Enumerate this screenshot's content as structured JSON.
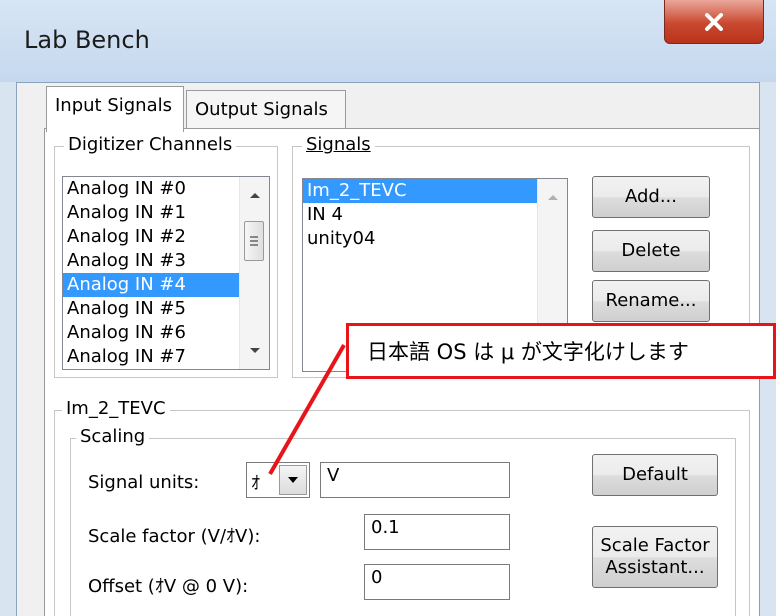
{
  "window": {
    "title": "Lab Bench"
  },
  "tabs": [
    {
      "label": "Input Signals",
      "active": true
    },
    {
      "label": "Output Signals",
      "active": false
    }
  ],
  "digitizer": {
    "group_label": "Digitizer Channels",
    "items": [
      "Analog IN #0",
      "Analog IN #1",
      "Analog IN #2",
      "Analog IN #3",
      "Analog IN #4",
      "Analog IN #5",
      "Analog IN #6",
      "Analog IN #7"
    ],
    "selected": "Analog IN #4"
  },
  "signals": {
    "group_label": "Signals",
    "items": [
      "Im_2_TEVC",
      "IN 4",
      "unity04"
    ],
    "selected": "Im_2_TEVC",
    "buttons": {
      "add": "Add...",
      "delete": "Delete",
      "rename": "Rename..."
    }
  },
  "signal_settings": {
    "group_label": "Im_2_TEVC",
    "scaling": {
      "group_label": "Scaling",
      "signal_units_label": "Signal units:",
      "unit_prefix": "ｵ",
      "unit_value": "V",
      "default_button": "Default",
      "scale_factor_label": "Scale factor (V/ｵV):",
      "scale_factor_value": "0.1",
      "offset_label": "Offset (ｵV @ 0 V):",
      "offset_value": "0",
      "assistant_button_line1": "Scale Factor",
      "assistant_button_line2": "Assistant..."
    }
  },
  "annotation": {
    "text": "日本語 OS は μ が文字化けします",
    "color": "#e8141a"
  }
}
